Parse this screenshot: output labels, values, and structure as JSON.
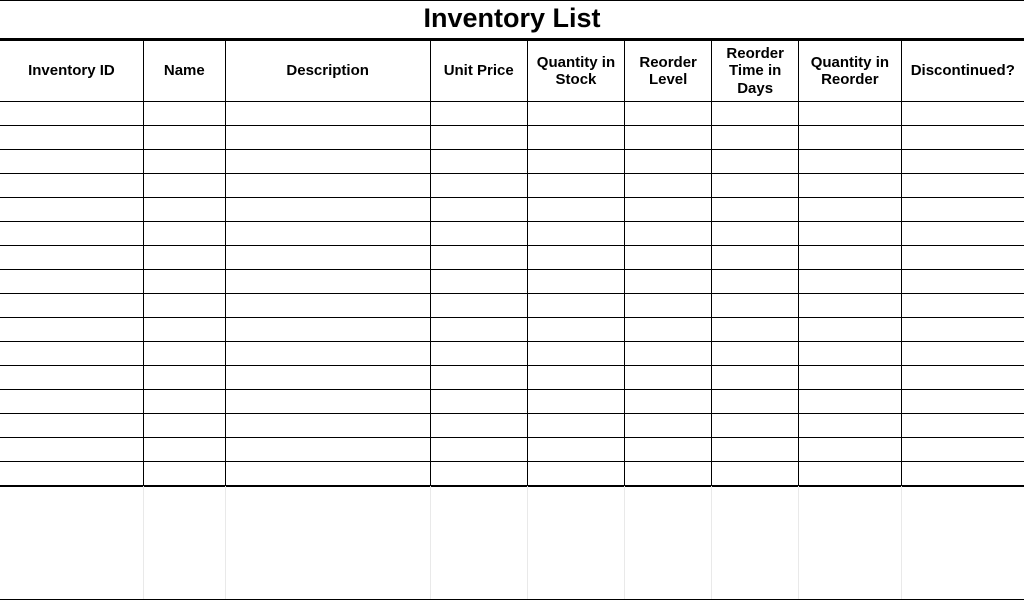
{
  "title": "Inventory List",
  "columns": [
    {
      "label": "Inventory ID",
      "key": "inventory_id"
    },
    {
      "label": "Name",
      "key": "name"
    },
    {
      "label": "Description",
      "key": "description"
    },
    {
      "label": "Unit Price",
      "key": "unit_price"
    },
    {
      "label": "Quantity in Stock",
      "key": "quantity_in_stock"
    },
    {
      "label": "Reorder Level",
      "key": "reorder_level"
    },
    {
      "label": "Reorder Time in Days",
      "key": "reorder_time_days"
    },
    {
      "label": "Quantity in Reorder",
      "key": "quantity_in_reorder"
    },
    {
      "label": "Discontinued?",
      "key": "discontinued"
    }
  ],
  "rows": [
    {
      "inventory_id": "",
      "name": "",
      "description": "",
      "unit_price": "",
      "quantity_in_stock": "",
      "reorder_level": "",
      "reorder_time_days": "",
      "quantity_in_reorder": "",
      "discontinued": ""
    },
    {
      "inventory_id": "",
      "name": "",
      "description": "",
      "unit_price": "",
      "quantity_in_stock": "",
      "reorder_level": "",
      "reorder_time_days": "",
      "quantity_in_reorder": "",
      "discontinued": ""
    },
    {
      "inventory_id": "",
      "name": "",
      "description": "",
      "unit_price": "",
      "quantity_in_stock": "",
      "reorder_level": "",
      "reorder_time_days": "",
      "quantity_in_reorder": "",
      "discontinued": ""
    },
    {
      "inventory_id": "",
      "name": "",
      "description": "",
      "unit_price": "",
      "quantity_in_stock": "",
      "reorder_level": "",
      "reorder_time_days": "",
      "quantity_in_reorder": "",
      "discontinued": ""
    },
    {
      "inventory_id": "",
      "name": "",
      "description": "",
      "unit_price": "",
      "quantity_in_stock": "",
      "reorder_level": "",
      "reorder_time_days": "",
      "quantity_in_reorder": "",
      "discontinued": ""
    },
    {
      "inventory_id": "",
      "name": "",
      "description": "",
      "unit_price": "",
      "quantity_in_stock": "",
      "reorder_level": "",
      "reorder_time_days": "",
      "quantity_in_reorder": "",
      "discontinued": ""
    },
    {
      "inventory_id": "",
      "name": "",
      "description": "",
      "unit_price": "",
      "quantity_in_stock": "",
      "reorder_level": "",
      "reorder_time_days": "",
      "quantity_in_reorder": "",
      "discontinued": ""
    },
    {
      "inventory_id": "",
      "name": "",
      "description": "",
      "unit_price": "",
      "quantity_in_stock": "",
      "reorder_level": "",
      "reorder_time_days": "",
      "quantity_in_reorder": "",
      "discontinued": ""
    },
    {
      "inventory_id": "",
      "name": "",
      "description": "",
      "unit_price": "",
      "quantity_in_stock": "",
      "reorder_level": "",
      "reorder_time_days": "",
      "quantity_in_reorder": "",
      "discontinued": ""
    },
    {
      "inventory_id": "",
      "name": "",
      "description": "",
      "unit_price": "",
      "quantity_in_stock": "",
      "reorder_level": "",
      "reorder_time_days": "",
      "quantity_in_reorder": "",
      "discontinued": ""
    },
    {
      "inventory_id": "",
      "name": "",
      "description": "",
      "unit_price": "",
      "quantity_in_stock": "",
      "reorder_level": "",
      "reorder_time_days": "",
      "quantity_in_reorder": "",
      "discontinued": ""
    },
    {
      "inventory_id": "",
      "name": "",
      "description": "",
      "unit_price": "",
      "quantity_in_stock": "",
      "reorder_level": "",
      "reorder_time_days": "",
      "quantity_in_reorder": "",
      "discontinued": ""
    },
    {
      "inventory_id": "",
      "name": "",
      "description": "",
      "unit_price": "",
      "quantity_in_stock": "",
      "reorder_level": "",
      "reorder_time_days": "",
      "quantity_in_reorder": "",
      "discontinued": ""
    },
    {
      "inventory_id": "",
      "name": "",
      "description": "",
      "unit_price": "",
      "quantity_in_stock": "",
      "reorder_level": "",
      "reorder_time_days": "",
      "quantity_in_reorder": "",
      "discontinued": ""
    },
    {
      "inventory_id": "",
      "name": "",
      "description": "",
      "unit_price": "",
      "quantity_in_stock": "",
      "reorder_level": "",
      "reorder_time_days": "",
      "quantity_in_reorder": "",
      "discontinued": ""
    },
    {
      "inventory_id": "",
      "name": "",
      "description": "",
      "unit_price": "",
      "quantity_in_stock": "",
      "reorder_level": "",
      "reorder_time_days": "",
      "quantity_in_reorder": "",
      "discontinued": ""
    }
  ]
}
